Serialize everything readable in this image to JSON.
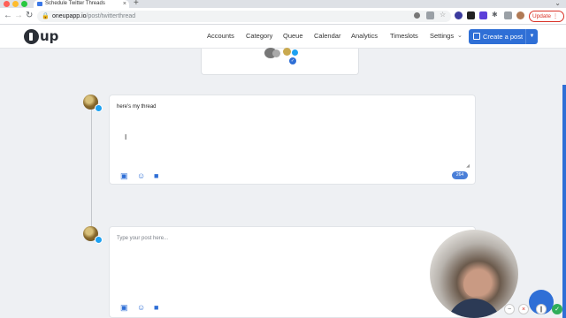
{
  "browser": {
    "tab_title": "Schedule Twitter Threads",
    "url_host": "oneupapp.io",
    "url_path": "/post/twitterthread",
    "update_label": "Update"
  },
  "app": {
    "logo_text": "up",
    "nav": [
      "Accounts",
      "Category",
      "Queue",
      "Calendar",
      "Analytics",
      "Timeslots",
      "Settings"
    ],
    "create_label": "Create a post"
  },
  "thread": {
    "post1_text": "here's my thread",
    "post1_count": "264",
    "post2_placeholder": "Type your post here..."
  },
  "colors": {
    "accent": "#2f6fd6",
    "twitter": "#1da1f2",
    "update": "#d93025"
  },
  "icons": [
    "image-icon",
    "emoji-icon",
    "video-icon",
    "text-cursor-icon",
    "calendar-icon"
  ]
}
